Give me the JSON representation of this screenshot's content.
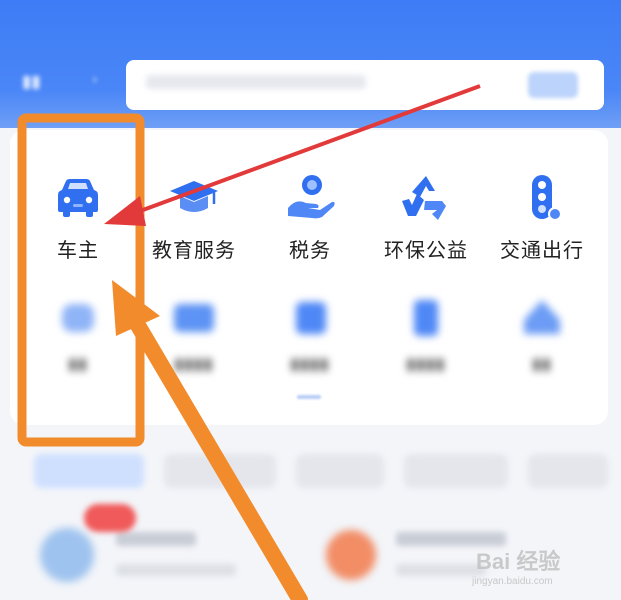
{
  "services_row1": [
    {
      "label": "车主",
      "icon": "car-icon"
    },
    {
      "label": "教育服务",
      "icon": "graduation-cap-icon"
    },
    {
      "label": "税务",
      "icon": "hand-coin-icon"
    },
    {
      "label": "环保公益",
      "icon": "recycle-icon"
    },
    {
      "label": "交通出行",
      "icon": "traffic-light-icon"
    }
  ],
  "colors": {
    "header": "#3d7cf6",
    "icon_blue": "#2f6ff0",
    "highlight_box": "#f28b2c",
    "arrow_red": "#e23a3a"
  },
  "watermark": {
    "text": "Bai 经验",
    "sub": "jingyan.baidu.com"
  }
}
